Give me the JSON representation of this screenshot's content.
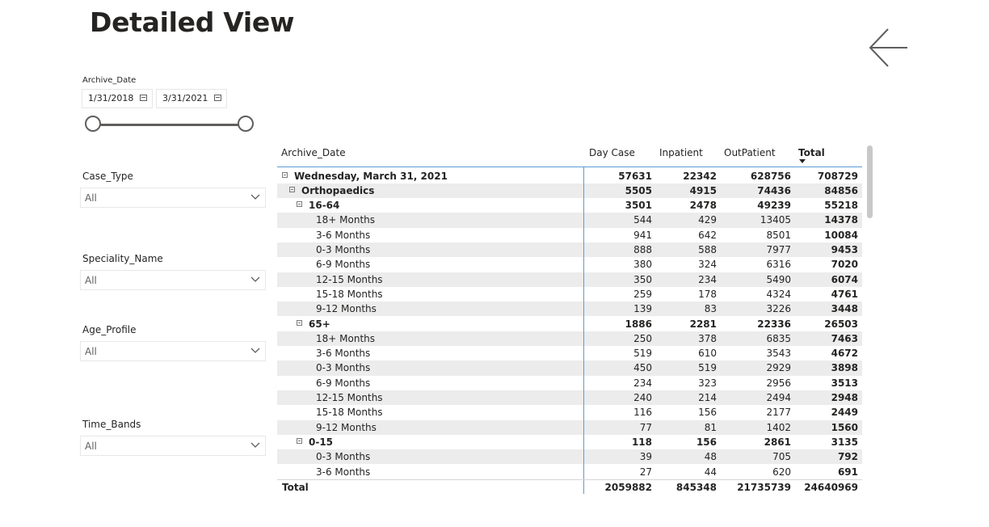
{
  "page": {
    "title": "Detailed View"
  },
  "date_slicer": {
    "label": "Archive_Date",
    "start": "1/31/2018",
    "end": "3/31/2021"
  },
  "filters": {
    "case_type": {
      "label": "Case_Type",
      "value": "All"
    },
    "speciality_name": {
      "label": "Speciality_Name",
      "value": "All"
    },
    "age_profile": {
      "label": "Age_Profile",
      "value": "All"
    },
    "time_bands": {
      "label": "Time_Bands",
      "value": "All"
    }
  },
  "matrix": {
    "columns": {
      "row_header": "Archive_Date",
      "day_case": "Day Case",
      "inpatient": "Inpatient",
      "outpatient": "OutPatient",
      "total": "Total"
    },
    "rows": [
      {
        "level": 0,
        "label": "Wednesday, March 31, 2021",
        "day_case": "57631",
        "inpatient": "22342",
        "outpatient": "628756",
        "total": "708729"
      },
      {
        "level": 1,
        "label": "Orthopaedics",
        "day_case": "5505",
        "inpatient": "4915",
        "outpatient": "74436",
        "total": "84856"
      },
      {
        "level": 2,
        "label": "16-64",
        "day_case": "3501",
        "inpatient": "2478",
        "outpatient": "49239",
        "total": "55218"
      },
      {
        "level": 3,
        "label": "18+ Months",
        "day_case": "544",
        "inpatient": "429",
        "outpatient": "13405",
        "total": "14378"
      },
      {
        "level": 3,
        "label": "3-6 Months",
        "day_case": "941",
        "inpatient": "642",
        "outpatient": "8501",
        "total": "10084"
      },
      {
        "level": 3,
        "label": "0-3 Months",
        "day_case": "888",
        "inpatient": "588",
        "outpatient": "7977",
        "total": "9453"
      },
      {
        "level": 3,
        "label": "6-9 Months",
        "day_case": "380",
        "inpatient": "324",
        "outpatient": "6316",
        "total": "7020"
      },
      {
        "level": 3,
        "label": "12-15 Months",
        "day_case": "350",
        "inpatient": "234",
        "outpatient": "5490",
        "total": "6074"
      },
      {
        "level": 3,
        "label": "15-18 Months",
        "day_case": "259",
        "inpatient": "178",
        "outpatient": "4324",
        "total": "4761"
      },
      {
        "level": 3,
        "label": "9-12 Months",
        "day_case": "139",
        "inpatient": "83",
        "outpatient": "3226",
        "total": "3448"
      },
      {
        "level": 2,
        "label": "65+",
        "day_case": "1886",
        "inpatient": "2281",
        "outpatient": "22336",
        "total": "26503"
      },
      {
        "level": 3,
        "label": "18+ Months",
        "day_case": "250",
        "inpatient": "378",
        "outpatient": "6835",
        "total": "7463"
      },
      {
        "level": 3,
        "label": "3-6 Months",
        "day_case": "519",
        "inpatient": "610",
        "outpatient": "3543",
        "total": "4672"
      },
      {
        "level": 3,
        "label": "0-3 Months",
        "day_case": "450",
        "inpatient": "519",
        "outpatient": "2929",
        "total": "3898"
      },
      {
        "level": 3,
        "label": "6-9 Months",
        "day_case": "234",
        "inpatient": "323",
        "outpatient": "2956",
        "total": "3513"
      },
      {
        "level": 3,
        "label": "12-15 Months",
        "day_case": "240",
        "inpatient": "214",
        "outpatient": "2494",
        "total": "2948"
      },
      {
        "level": 3,
        "label": "15-18 Months",
        "day_case": "116",
        "inpatient": "156",
        "outpatient": "2177",
        "total": "2449"
      },
      {
        "level": 3,
        "label": "9-12 Months",
        "day_case": "77",
        "inpatient": "81",
        "outpatient": "1402",
        "total": "1560"
      },
      {
        "level": 2,
        "label": "0-15",
        "day_case": "118",
        "inpatient": "156",
        "outpatient": "2861",
        "total": "3135"
      },
      {
        "level": 3,
        "label": "0-3 Months",
        "day_case": "39",
        "inpatient": "48",
        "outpatient": "705",
        "total": "792"
      },
      {
        "level": 3,
        "label": "3-6 Months",
        "day_case": "27",
        "inpatient": "44",
        "outpatient": "620",
        "total": "691"
      }
    ],
    "grand_total": {
      "label": "Total",
      "day_case": "2059882",
      "inpatient": "845348",
      "outpatient": "21735739",
      "total": "24640969"
    }
  },
  "colors": {
    "accent_line": "#5b9bd5",
    "row_shade": "#ececec",
    "text": "#252423"
  },
  "icons": {
    "back": "back-arrow-icon",
    "calendar": "calendar-icon",
    "dropdown": "chevron-down-icon",
    "expand": "collapse-icon"
  }
}
